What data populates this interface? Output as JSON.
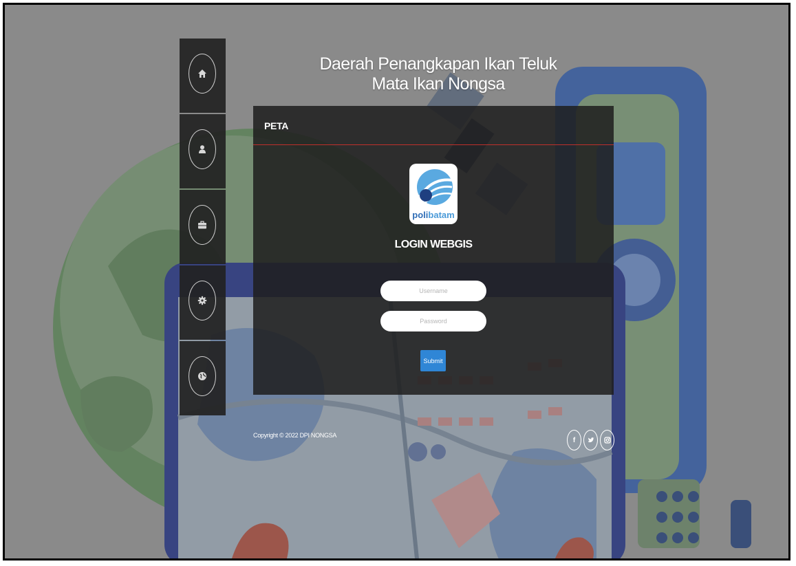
{
  "header": {
    "title": "Daerah Penangkapan Ikan Teluk Mata Ikan Nongsa"
  },
  "sidebar": {
    "items": [
      {
        "icon": "home-icon"
      },
      {
        "icon": "user-icon"
      },
      {
        "icon": "briefcase-icon"
      },
      {
        "icon": "gear-icon"
      },
      {
        "icon": "globe-icon"
      }
    ]
  },
  "panel": {
    "header": "PETA",
    "logo": {
      "part1": "poli",
      "part2": "batam"
    },
    "login_title": "LOGIN WEBGIS",
    "username_placeholder": "Username",
    "password_placeholder": "Password",
    "submit_label": "Submit"
  },
  "footer": {
    "copyright": "Copyright © 2022 DPI NONGSA",
    "social": {
      "facebook": "f",
      "twitter": "t",
      "instagram": "ig"
    }
  },
  "colors": {
    "accent": "#2f86d6",
    "header_rule": "#c0302b",
    "panel_bg": "#1e1e1e"
  }
}
